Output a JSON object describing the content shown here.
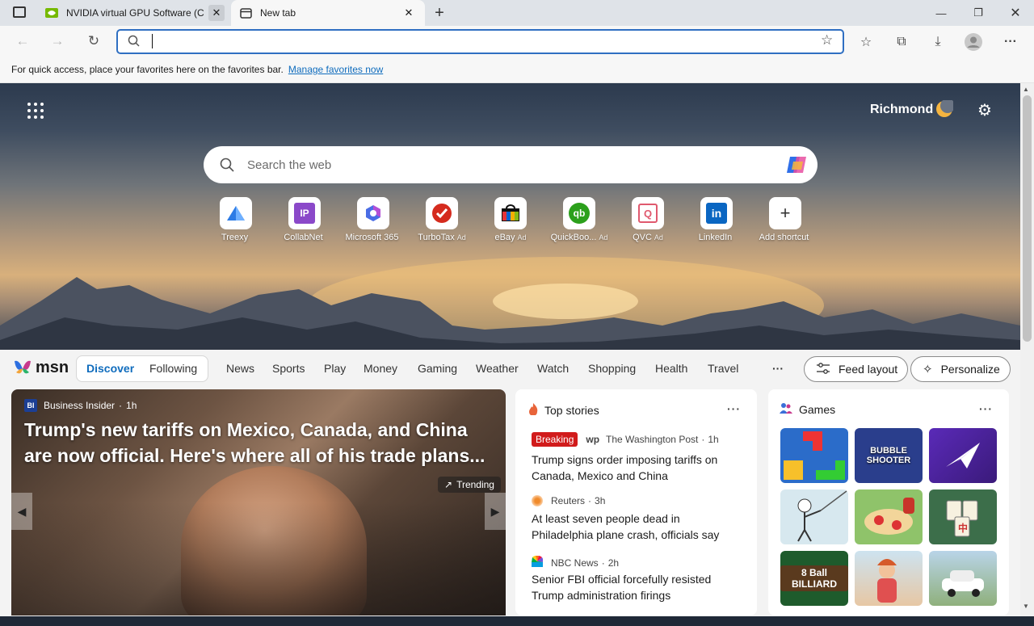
{
  "browser": {
    "tabs": [
      {
        "title": "NVIDIA virtual GPU Software (C",
        "icon": "nvidia-icon"
      },
      {
        "title": "New tab",
        "icon": "newtab-icon"
      }
    ],
    "address_value": "",
    "favorites_bar": {
      "text": "For quick access, place your favorites here on the favorites bar.",
      "link": "Manage favorites now"
    }
  },
  "hero": {
    "location": "Richmond",
    "search_placeholder": "Search the web",
    "shortcuts": [
      {
        "label": "Treexy",
        "ad": "",
        "icon": "treexy-icon"
      },
      {
        "label": "CollabNet",
        "ad": "",
        "icon": "collabnet-icon"
      },
      {
        "label": "Microsoft 365",
        "ad": "",
        "icon": "m365-icon"
      },
      {
        "label": "TurboTax",
        "ad": "Ad",
        "icon": "turbotax-icon"
      },
      {
        "label": "eBay",
        "ad": "Ad",
        "icon": "ebay-icon"
      },
      {
        "label": "QuickBoo...",
        "ad": "Ad",
        "icon": "quickbooks-icon"
      },
      {
        "label": "QVC",
        "ad": "Ad",
        "icon": "qvc-icon"
      },
      {
        "label": "LinkedIn",
        "ad": "",
        "icon": "linkedin-icon"
      },
      {
        "label": "Add shortcut",
        "ad": "",
        "icon": "plus-icon"
      }
    ]
  },
  "msn": {
    "logo": "msn",
    "tabs": [
      "Discover",
      "Following"
    ],
    "nav": [
      "News",
      "Sports",
      "Play",
      "Money",
      "Gaming",
      "Weather",
      "Watch",
      "Shopping",
      "Health",
      "Travel"
    ],
    "more": "···",
    "feed_layout": "Feed layout",
    "personalize": "Personalize"
  },
  "featured": {
    "source": "Business Insider",
    "source_abbr": "BI",
    "age": "1h",
    "headline": "Trump's new tariffs on Mexico, Canada, and China are now official. Here's where all of his trade plans...",
    "badge": "Trending"
  },
  "top_stories": {
    "title": "Top stories",
    "items": [
      {
        "badge": "Breaking",
        "source": "The Washington Post",
        "age": "1h",
        "headline": "Trump signs order imposing tariffs on Canada, Mexico and China"
      },
      {
        "badge": "",
        "source": "Reuters",
        "age": "3h",
        "headline": "At least seven people dead in Philadelphia plane crash, officials say"
      },
      {
        "badge": "",
        "source": "NBC News",
        "age": "2h",
        "headline": "Senior FBI official forcefully resisted Trump administration firings"
      }
    ]
  },
  "games": {
    "title": "Games",
    "tiles": [
      "",
      "BUBBLE SHOOTER",
      "",
      "",
      "",
      "",
      "8 Ball BILLIARD",
      "",
      ""
    ]
  },
  "colors": {
    "accent": "#0f6cbd",
    "breaking": "#d11b1b"
  }
}
